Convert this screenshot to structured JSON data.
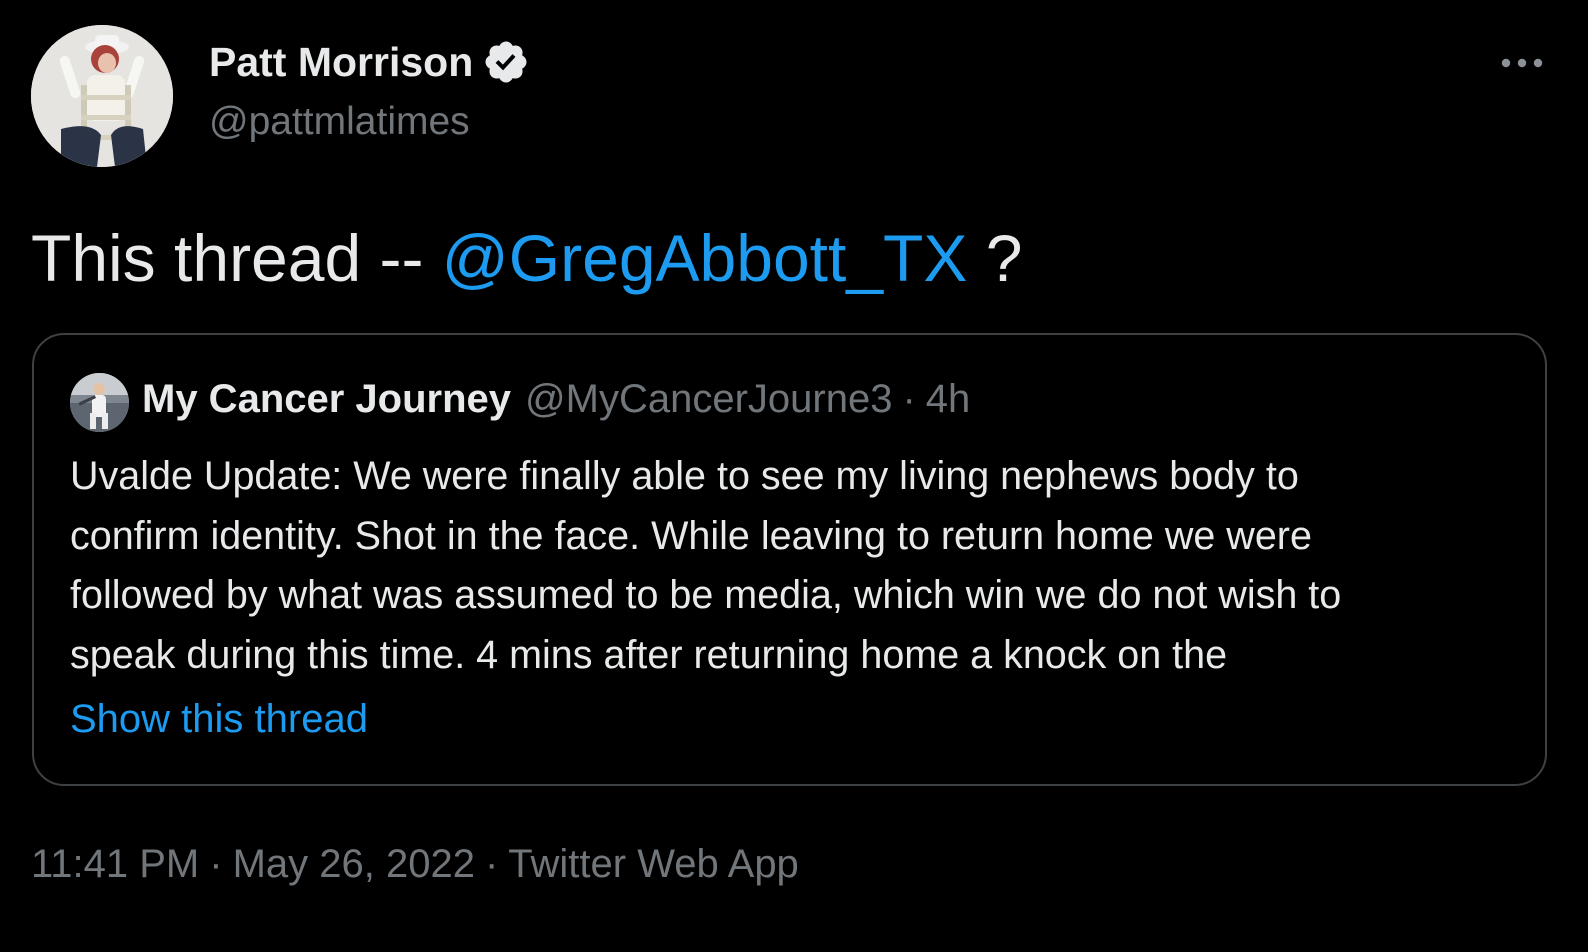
{
  "author": {
    "display_name": "Patt Morrison",
    "handle": "@pattmlatimes",
    "verified_icon": "verified-badge-icon",
    "more_icon": "ellipsis-icon"
  },
  "tweet": {
    "text_prefix": "This thread -- ",
    "mention": "@GregAbbott_TX",
    "text_suffix": " ?"
  },
  "quoted_tweet": {
    "display_name": "My Cancer Journey",
    "handle": "@MyCancerJourne3",
    "separator": "·",
    "time": "4h",
    "lines": [
      "Uvalde Update: We were finally able to see my living nephews body to",
      "confirm identity. Shot in the face. While leaving to return home we were",
      "followed by what was assumed to be media, which win we do not wish to",
      "speak during this time. 4 mins after returning home a knock on the"
    ],
    "show_thread": "Show this thread"
  },
  "meta": {
    "time": "11:41 PM",
    "date": "May 26, 2022",
    "source": "Twitter Web App",
    "separator": "·"
  },
  "colors": {
    "background": "#000000",
    "text": "#e7e9ea",
    "secondary": "#71767b",
    "accent": "#1d9bf0",
    "border": "#3e4144"
  }
}
